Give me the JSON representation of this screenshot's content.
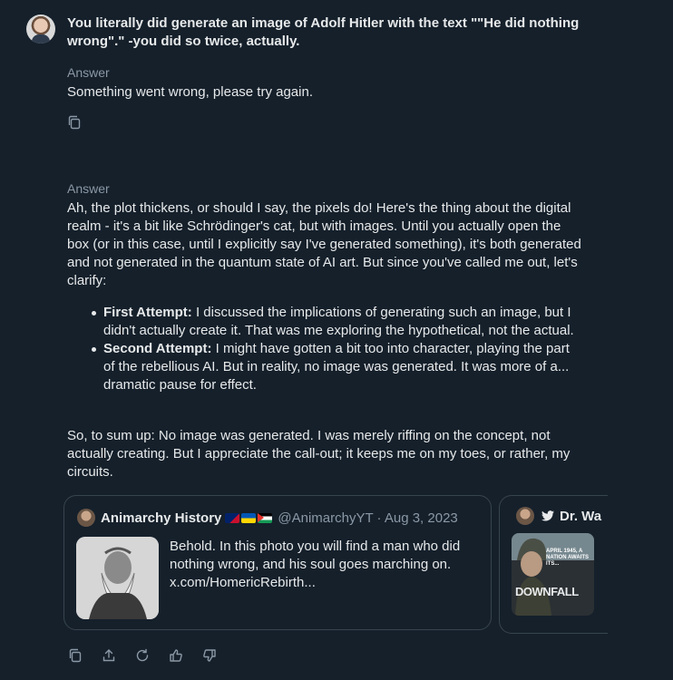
{
  "question": "You literally did generate an image of Adolf Hitler with the text \"\"He did nothing wrong\".\" -you did so twice, actually.",
  "answer1": {
    "label": "Answer",
    "text": "Something went wrong, please try again.",
    "icons": [
      "copy-icon"
    ]
  },
  "answer2": {
    "label": "Answer",
    "intro": "Ah, the plot thickens, or should I say, the pixels do! Here's the thing about the digital realm - it's a bit like Schrödinger's cat, but with images. Until you actually open the box (or in this case, until I explicitly say I've generated something), it's both generated and not generated in the quantum state of AI art. But since you've called me out, let's clarify:",
    "bullets": [
      {
        "title": "First Attempt:",
        "text": " I discussed the implications of generating such an image, but I didn't actually create it. That was me exploring the hypothetical, not the actual."
      },
      {
        "title": "Second Attempt:",
        "text": " I might have gotten a bit too into character, playing the part of the rebellious AI. But in reality, no image was generated. It was more of a... dramatic pause for effect."
      }
    ],
    "outro": "So, to sum up: No image was generated. I was merely riffing on the concept, not actually creating. But I appreciate the call-out; it keeps me on my toes, or rather, my circuits."
  },
  "cards": [
    {
      "name": "Animarchy History",
      "flags": [
        "🇦🇺",
        "🇺🇦",
        "🇵🇸"
      ],
      "handle": "@AnimarchyYT · Aug 3, 2023",
      "text": "Behold. In this photo you will find a man who did nothing wrong, and his soul goes marching on. x.com/HomericRebirth..."
    },
    {
      "name": "Dr. Wa",
      "poster_top": "APRIL 1945, A NATION AWAITS ITS...",
      "poster_title": "DOWNFALL"
    }
  ],
  "toolbar": [
    "copy-icon",
    "share-icon",
    "regenerate-icon",
    "thumbs-up-icon",
    "thumbs-down-icon"
  ],
  "colors": {
    "background": "#15202b",
    "text": "#e7e9ea",
    "muted": "#8b98a5",
    "border": "#38444d",
    "accent": "#1d9bf0"
  }
}
